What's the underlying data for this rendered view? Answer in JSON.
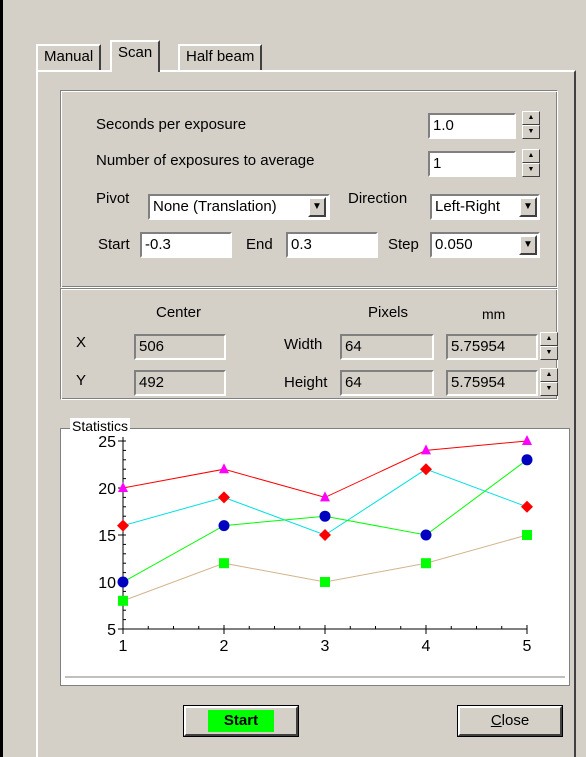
{
  "tabs": [
    {
      "label": "Manual"
    },
    {
      "label": "Scan"
    },
    {
      "label": "Half beam"
    }
  ],
  "scan": {
    "seconds_label": "Seconds per exposure",
    "seconds_value": "1.0",
    "exposures_label": "Number of exposures to average",
    "exposures_value": "1",
    "pivot_label": "Pivot",
    "pivot_value": "None (Translation)",
    "direction_label": "Direction",
    "direction_value": "Left-Right",
    "start_label": "Start",
    "start_value": "-0.3",
    "end_label": "End",
    "end_value": "0.3",
    "step_label": "Step",
    "step_value": "0.050"
  },
  "region": {
    "center_header": "Center",
    "pixels_header": "Pixels",
    "mm_header": "mm",
    "x_label": "X",
    "x_value": "506",
    "y_label": "Y",
    "y_value": "492",
    "width_label": "Width",
    "width_px": "64",
    "width_mm": "5.75954",
    "height_label": "Height",
    "height_px": "64",
    "height_mm": "5.75954"
  },
  "statistics": {
    "label": "Statistics"
  },
  "chart_data": {
    "type": "line",
    "x": [
      1,
      2,
      3,
      4,
      5
    ],
    "xlim": [
      1,
      5
    ],
    "ylim": [
      5,
      25
    ],
    "yticks": [
      5,
      10,
      15,
      20,
      25
    ],
    "xticks": [
      1,
      2,
      3,
      4,
      5
    ],
    "grid": false,
    "series": [
      {
        "values": [
          20,
          22,
          19,
          24,
          25
        ],
        "line_color": "#ff0000",
        "marker_color": "#ff00ff",
        "marker": "triangle"
      },
      {
        "values": [
          16,
          19,
          15,
          22,
          18
        ],
        "line_color": "#00e0e0",
        "marker_color": "#ff0000",
        "marker": "diamond"
      },
      {
        "values": [
          10,
          16,
          17,
          15,
          23
        ],
        "line_color": "#00ff00",
        "marker_color": "#0000c0",
        "marker": "circle"
      },
      {
        "values": [
          8,
          12,
          10,
          12,
          15
        ],
        "line_color": "#d2b48c",
        "marker_color": "#00ff00",
        "marker": "square"
      }
    ]
  },
  "buttons": {
    "start_label": "Start",
    "close_label": "Close"
  }
}
